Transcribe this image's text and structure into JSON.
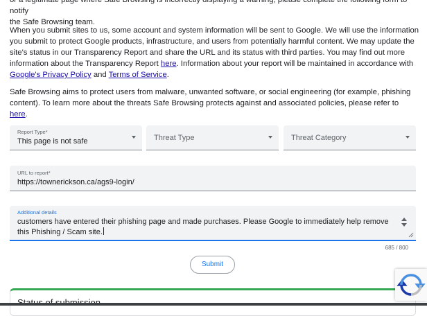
{
  "intro": {
    "line_top_prefix": "or a legitimate page where Safe Browsing is incorrectly displaying a warning, please complete the following form to notify",
    "line_top_suffix": "the Safe Browsing team.",
    "submit_info_1": "When you submit sites to us, some account and system information will be sent to Google. We will use the information you submit to protect Google products, infrastructure, and users from potentially harmful content. We may update the site's status in our Transparency Report and share the URL and its status with third parties. You may find out more information about the Transparency Report ",
    "here_link_1": "here",
    "submit_info_2": ". Information about your report will be maintained in accordance with ",
    "privacy_link": "Google's Privacy Policy",
    "and_text": " and ",
    "terms_link": "Terms of Service",
    "end_period": ".",
    "aims_text": "Safe Browsing aims to protect users from malware, unwanted software, or social engineering (for example, phishing content). To learn more about the threats Safe Browsing protects against and associated policies, please refer to ",
    "here_link_2": "here",
    "aims_end": "."
  },
  "form": {
    "report_type": {
      "label": "Report Type*",
      "value": "This page is not safe"
    },
    "threat_type": {
      "placeholder": "Threat Type"
    },
    "threat_category": {
      "placeholder": "Threat Category"
    },
    "url": {
      "label": "URL to report*",
      "value": "https://townerickson.ca/ags9-login/"
    },
    "details": {
      "label": "Additional details",
      "value": "customers have entered their phishing page and made purchases. Please Google to immediately help remove this Phishing / Scam site."
    },
    "counter": "685 / 800",
    "submit_label": "Submit"
  },
  "status": {
    "title": "Status of submission"
  },
  "colors": {
    "accent": "#1a73e8",
    "link": "#1a0dab",
    "success": "#34a853"
  },
  "icons": {
    "dropdown": "caret-down-icon",
    "spinner": "spinner-arrows-icon",
    "resize": "resize-handle-icon",
    "recaptcha": "recaptcha-logo-icon"
  }
}
